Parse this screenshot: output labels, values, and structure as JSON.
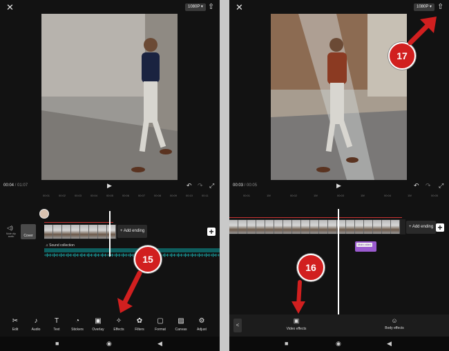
{
  "left": {
    "close_icon": "close-icon",
    "resolution": "1080P ▾",
    "export_icon": "upload-icon",
    "time_current": "00:04",
    "time_sep": " / ",
    "time_total": "01:07",
    "ruler_ticks": [
      "00:01",
      "00:02",
      "00:03",
      "00:04",
      "00:05",
      "00:06",
      "00:07",
      "00:08",
      "00:09",
      "00:10",
      "00:11"
    ],
    "mute_label": "Mute clip audio",
    "cover_label": "Cover",
    "add_ending": "+ Add ending",
    "sound_label": "♫ Sound collection",
    "step_badge": "15",
    "toolbar": [
      {
        "icon": "✂",
        "label": "Edit"
      },
      {
        "icon": "♪",
        "label": "Audio"
      },
      {
        "icon": "T",
        "label": "Text"
      },
      {
        "icon": "◔",
        "label": "Stickers"
      },
      {
        "icon": "▣",
        "label": "Overlay"
      },
      {
        "icon": "✧",
        "label": "Effects"
      },
      {
        "icon": "✿",
        "label": "Filters"
      },
      {
        "icon": "▢",
        "label": "Format"
      },
      {
        "icon": "▨",
        "label": "Canvas"
      },
      {
        "icon": "⚙",
        "label": "Adjust"
      }
    ]
  },
  "right": {
    "close_icon": "close-icon",
    "resolution": "1080P ▾",
    "export_icon": "upload-icon",
    "time_current": "00:03",
    "time_sep": " / ",
    "time_total": "00:05",
    "ruler_ticks": [
      "00:01",
      "15f",
      "00:02",
      "15f",
      "00:03",
      "15f",
      "00:04",
      "15f",
      "00:05"
    ],
    "add_ending": "+ Add ending",
    "effect_clip": "Main video",
    "step_badge_top": "17",
    "step_badge_bottom": "16",
    "back_label": "<",
    "video_effects": "Video effects",
    "body_effects": "Body effects"
  },
  "colors": {
    "badge": "#d11f1f",
    "effect_clip": "#9b5bd0",
    "audio_wave": "#1aa3a3",
    "playhead": "#ffffff"
  }
}
